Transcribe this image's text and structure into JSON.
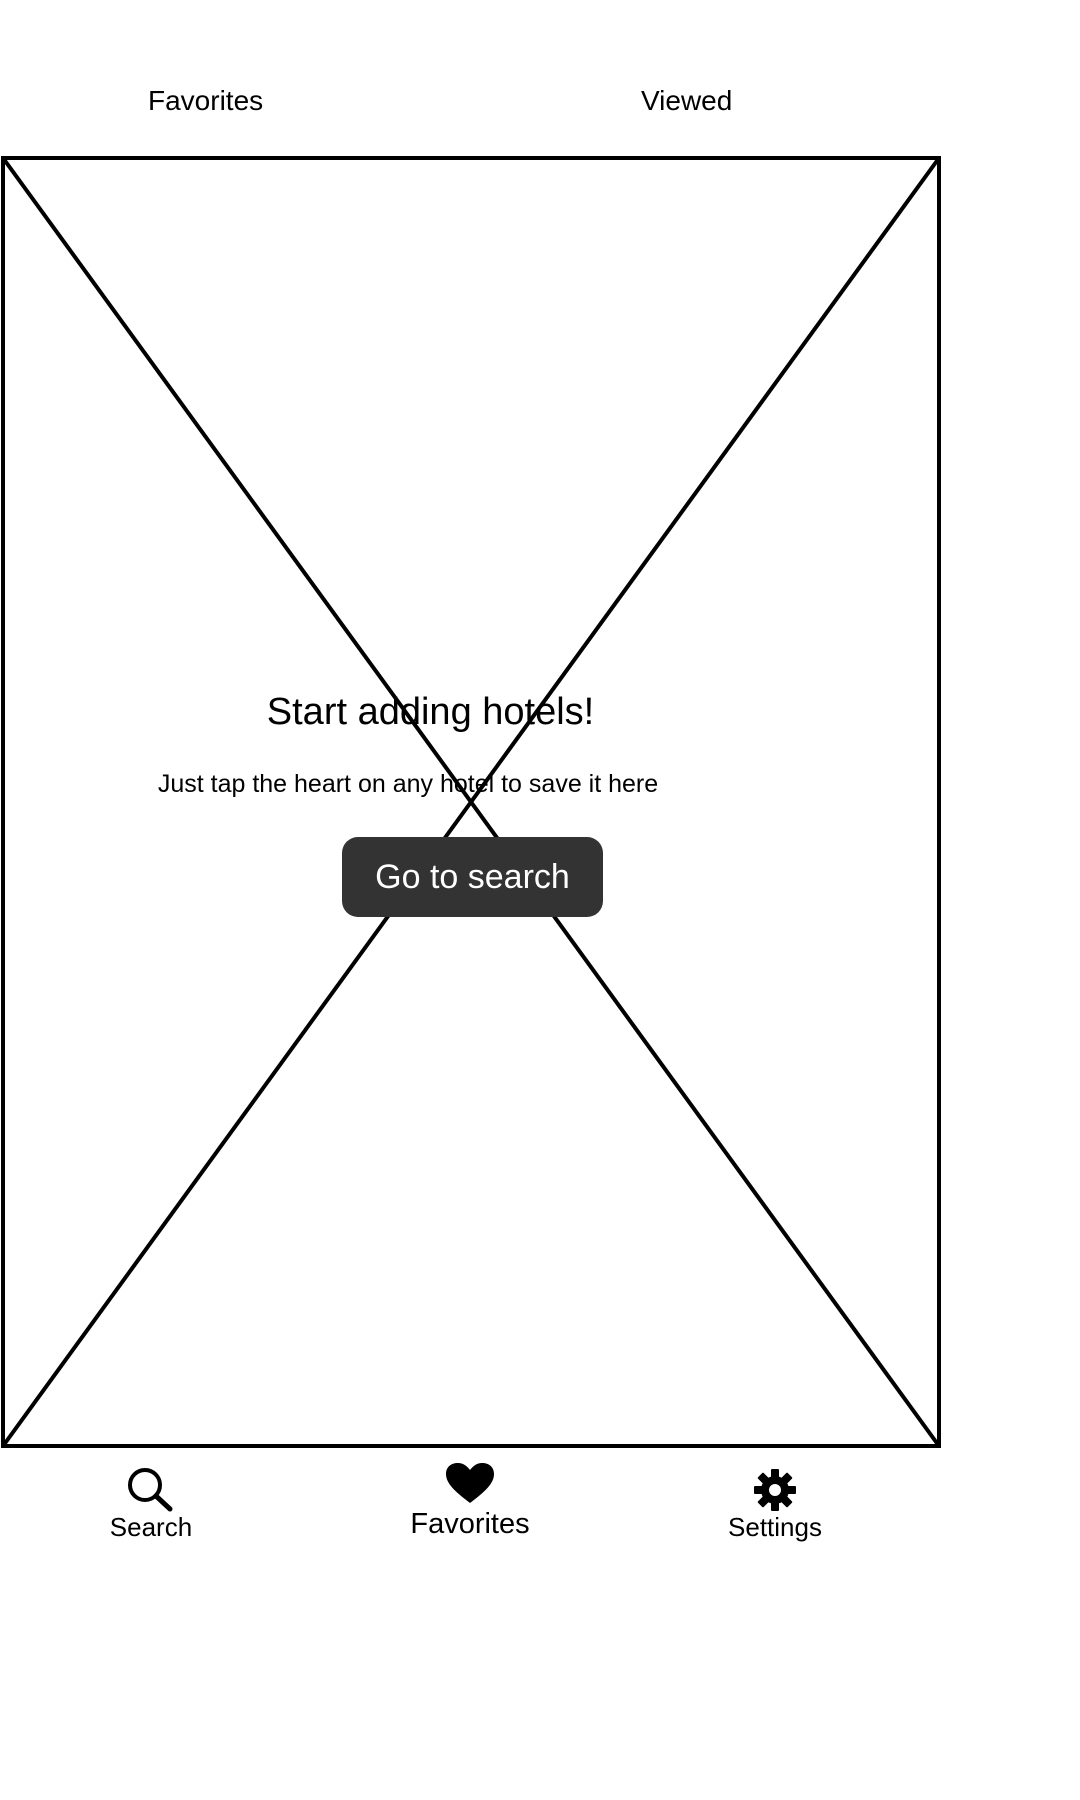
{
  "tabs": {
    "favorites": "Favorites",
    "viewed": "Viewed"
  },
  "empty_state": {
    "title": "Start adding hotels!",
    "subtitle": "Just tap the heart on any hotel to save it here",
    "button_label": "Go to search"
  },
  "bottom_nav": {
    "search": {
      "label": "Search",
      "icon": "search-icon"
    },
    "favorites": {
      "label": "Favorites",
      "icon": "heart-icon"
    },
    "settings": {
      "label": "Settings",
      "icon": "gear-icon"
    }
  },
  "colors": {
    "button_background": "#333333",
    "button_text": "#ffffff",
    "stroke": "#000000"
  }
}
